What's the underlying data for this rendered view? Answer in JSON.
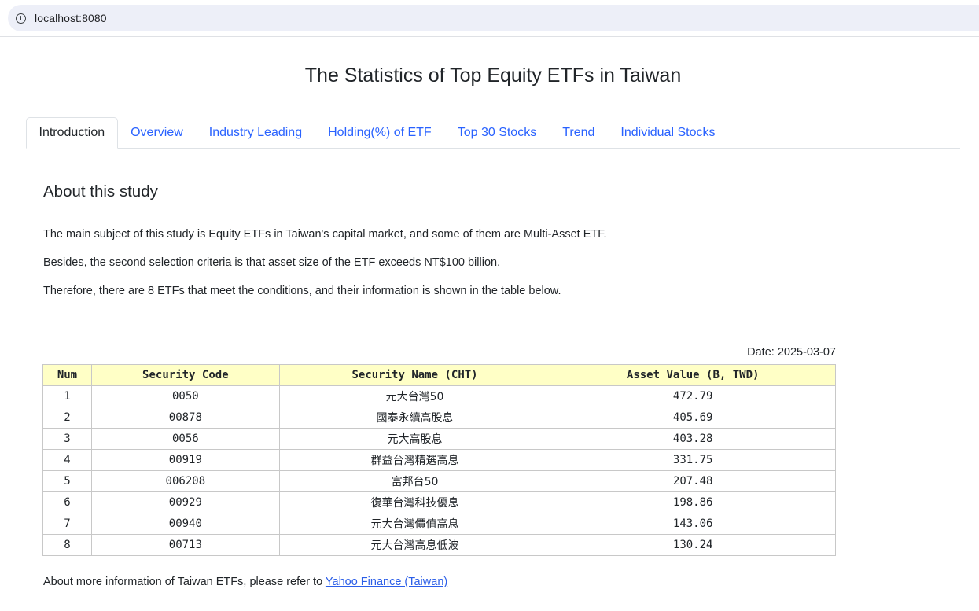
{
  "browser": {
    "url": "localhost:8080"
  },
  "page": {
    "title": "The Statistics of Top Equity ETFs in Taiwan",
    "tabs": [
      {
        "label": "Introduction",
        "active": true
      },
      {
        "label": "Overview"
      },
      {
        "label": "Industry Leading"
      },
      {
        "label": "Holding(%) of ETF"
      },
      {
        "label": "Top 30 Stocks"
      },
      {
        "label": "Trend"
      },
      {
        "label": "Individual Stocks"
      }
    ],
    "section_title": "About this study",
    "paragraphs": [
      "The main subject of this study is Equity ETFs in Taiwan's capital market, and some of them are Multi-Asset ETF.",
      "Besides, the second selection criteria is that asset size of the ETF exceeds NT$100 billion.",
      "Therefore, there are 8 ETFs that meet the conditions, and their information is shown in the table below."
    ],
    "date_label": "Date: 2025-03-07",
    "table": {
      "headers": [
        "Num",
        "Security Code",
        "Security Name (CHT)",
        "Asset Value (B, TWD)"
      ],
      "rows": [
        [
          "1",
          "0050",
          "元大台灣50",
          "472.79"
        ],
        [
          "2",
          "00878",
          "國泰永續高股息",
          "405.69"
        ],
        [
          "3",
          "0056",
          "元大高股息",
          "403.28"
        ],
        [
          "4",
          "00919",
          "群益台灣精選高息",
          "331.75"
        ],
        [
          "5",
          "006208",
          "富邦台50",
          "207.48"
        ],
        [
          "6",
          "00929",
          "復華台灣科技優息",
          "198.86"
        ],
        [
          "7",
          "00940",
          "元大台灣價值高息",
          "143.06"
        ],
        [
          "8",
          "00713",
          "元大台灣高息低波",
          "130.24"
        ]
      ]
    },
    "footer_text": "About more information of Taiwan ETFs, please refer to ",
    "footer_link": "Yahoo Finance (Taiwan)",
    "colors": {
      "link": "#2962ff",
      "header_bg": "#ffffc6"
    }
  }
}
